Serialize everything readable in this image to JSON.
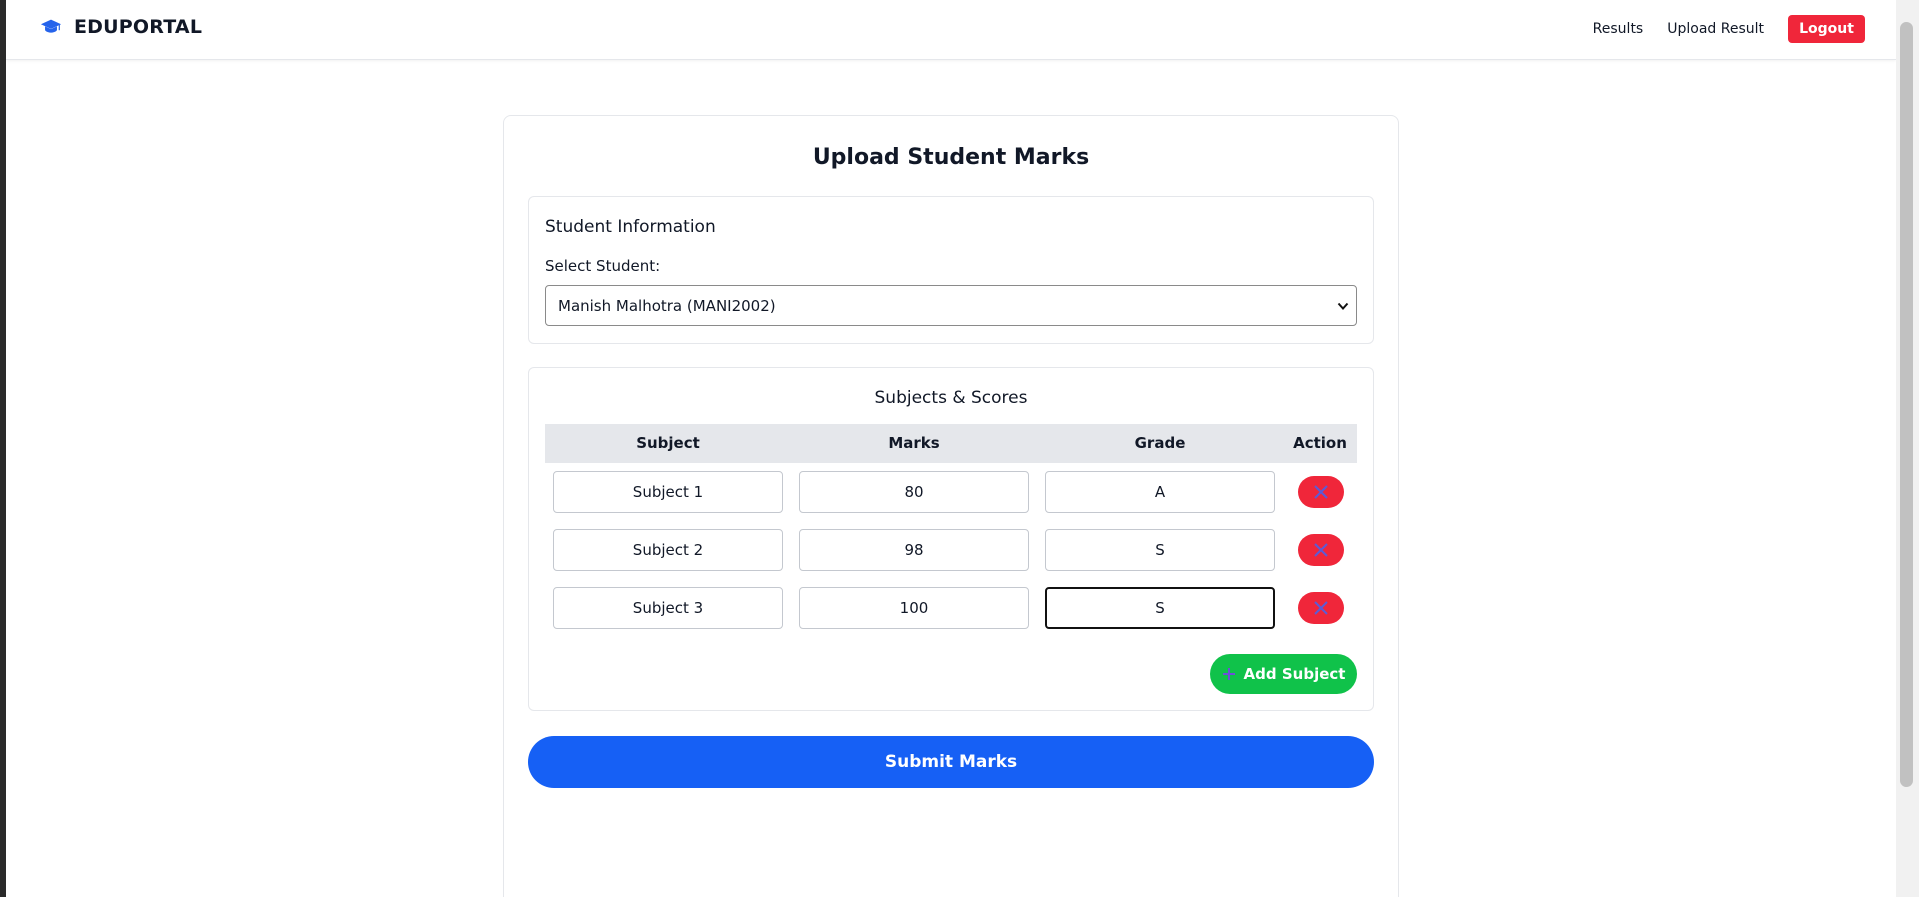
{
  "navbar": {
    "brand": "EDUPORTAL",
    "links": [
      "Results",
      "Upload Result"
    ],
    "logout_label": "Logout"
  },
  "form": {
    "title": "Upload Student Marks",
    "student_info": {
      "heading": "Student Information",
      "select_label": "Select Student:",
      "selected_student": "Manish Malhotra (MANI2002)"
    },
    "subjects": {
      "heading": "Subjects & Scores",
      "columns": [
        "Subject",
        "Marks",
        "Grade",
        "Action"
      ],
      "rows": [
        {
          "subject": "Subject 1",
          "marks": "80",
          "grade": "A"
        },
        {
          "subject": "Subject 2",
          "marks": "98",
          "grade": "S"
        },
        {
          "subject": "Subject 3",
          "marks": "100",
          "grade": "S"
        }
      ],
      "add_label": "Add Subject"
    },
    "submit_label": "Submit Marks"
  },
  "colors": {
    "accent_blue": "#1660f5",
    "danger_red": "#f0263a",
    "success_green": "#10c24a"
  },
  "icons": {
    "brand": "graduation-cap-icon",
    "remove": "close-icon",
    "add": "plus-icon",
    "select": "chevron-down-icon"
  }
}
